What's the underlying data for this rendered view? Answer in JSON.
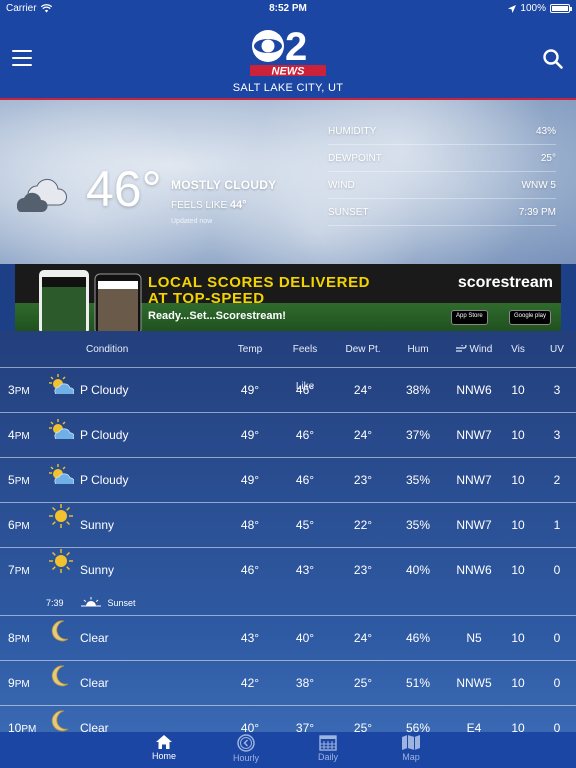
{
  "status_bar": {
    "carrier": "Carrier",
    "time": "8:52 PM",
    "battery": "100%"
  },
  "header": {
    "logo_number": "2",
    "logo_text": "NEWS",
    "city": "SALT LAKE CITY, UT"
  },
  "current": {
    "temp": "46°",
    "condition": "MOSTLY CLOUDY",
    "feels_label": "FEELS LIKE",
    "feels_value": "44°",
    "updated": "Updated now",
    "stats": [
      {
        "label": "HUMIDITY",
        "value": "43%"
      },
      {
        "label": "DEWPOINT",
        "value": "25°"
      },
      {
        "label": "WIND",
        "value": "WNW 5"
      },
      {
        "label": "SUNSET",
        "value": "7:39 PM"
      }
    ]
  },
  "ad": {
    "title_line1": "LOCAL SCORES DELIVERED",
    "title_line2": "AT TOP-SPEED",
    "subtitle": "Ready...Set...Scorestream!",
    "brand": "scorestream",
    "badge_appstore": "App Store",
    "badge_google": "Google play"
  },
  "table": {
    "headers": {
      "condition": "Condition",
      "temp": "Temp",
      "feels": "Feels Like",
      "dew": "Dew Pt.",
      "hum": "Hum",
      "wind": "Wind",
      "vis": "Vis",
      "uv": "UV"
    },
    "rows": [
      {
        "hour": "3",
        "ampm": "PM",
        "icon": "partly-cloudy-icon",
        "condition": "P Cloudy",
        "temp": "49°",
        "feels": "46°",
        "dew": "24°",
        "hum": "38%",
        "wind": "NNW6",
        "vis": "10",
        "uv": "3"
      },
      {
        "hour": "4",
        "ampm": "PM",
        "icon": "partly-cloudy-icon",
        "condition": "P Cloudy",
        "temp": "49°",
        "feels": "46°",
        "dew": "24°",
        "hum": "37%",
        "wind": "NNW7",
        "vis": "10",
        "uv": "3"
      },
      {
        "hour": "5",
        "ampm": "PM",
        "icon": "partly-cloudy-icon",
        "condition": "P Cloudy",
        "temp": "49°",
        "feels": "46°",
        "dew": "23°",
        "hum": "35%",
        "wind": "NNW7",
        "vis": "10",
        "uv": "2"
      },
      {
        "hour": "6",
        "ampm": "PM",
        "icon": "sun-icon",
        "condition": "Sunny",
        "temp": "48°",
        "feels": "45°",
        "dew": "22°",
        "hum": "35%",
        "wind": "NNW7",
        "vis": "10",
        "uv": "1"
      },
      {
        "hour": "7",
        "ampm": "PM",
        "icon": "sun-icon",
        "condition": "Sunny",
        "temp": "46°",
        "feels": "43°",
        "dew": "23°",
        "hum": "40%",
        "wind": "NNW6",
        "vis": "10",
        "uv": "0",
        "sunset_time": "7:39",
        "sunset_label": "Sunset"
      },
      {
        "hour": "8",
        "ampm": "PM",
        "icon": "moon-icon",
        "condition": "Clear",
        "temp": "43°",
        "feels": "40°",
        "dew": "24°",
        "hum": "46%",
        "wind": "N5",
        "vis": "10",
        "uv": "0"
      },
      {
        "hour": "9",
        "ampm": "PM",
        "icon": "moon-icon",
        "condition": "Clear",
        "temp": "42°",
        "feels": "38°",
        "dew": "25°",
        "hum": "51%",
        "wind": "NNW5",
        "vis": "10",
        "uv": "0"
      },
      {
        "hour": "10",
        "ampm": "PM",
        "icon": "moon-icon",
        "condition": "Clear",
        "temp": "40°",
        "feels": "37°",
        "dew": "25°",
        "hum": "56%",
        "wind": "E4",
        "vis": "10",
        "uv": "0"
      }
    ]
  },
  "tabs": [
    {
      "label": "Home",
      "icon": "home-icon",
      "active": true
    },
    {
      "label": "Hourly",
      "icon": "clock-icon",
      "active": false
    },
    {
      "label": "Daily",
      "icon": "calendar-icon",
      "active": false
    },
    {
      "label": "Map",
      "icon": "map-icon",
      "active": false
    }
  ],
  "colors": {
    "header_blue": "#1c46a3",
    "accent_red": "#c9223a",
    "sun_yellow": "#f2c22e"
  }
}
